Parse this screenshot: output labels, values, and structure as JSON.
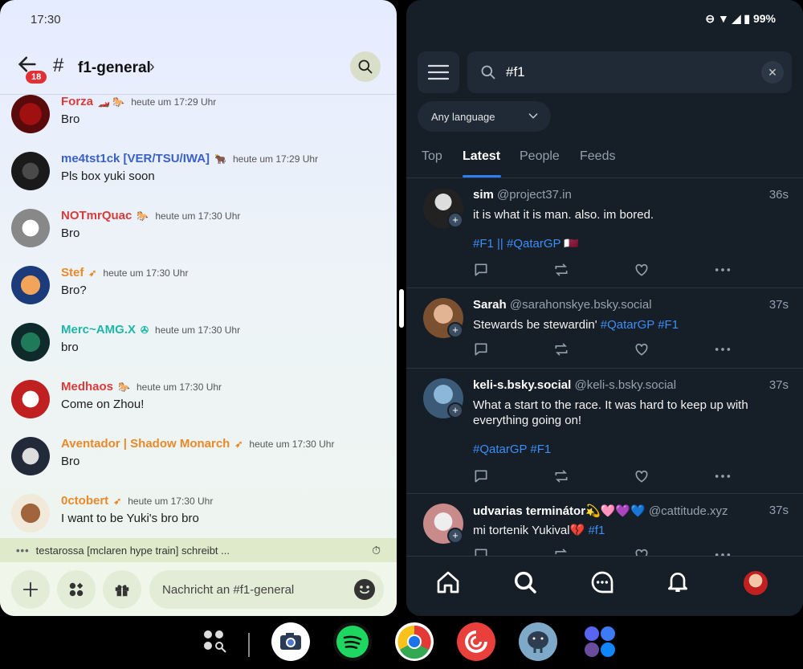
{
  "discord": {
    "status_time": "17:30",
    "badge_count": "18",
    "channel_hash": "#",
    "channel_name": "f1-general",
    "messages": [
      {
        "user": "Forza",
        "deco": "🏎️ 🐎",
        "time": "heute um 17:29 Uhr",
        "text": "Bro",
        "color": "#d93b3b"
      },
      {
        "user": "me4tst1ck [VER/TSU/IWA]",
        "deco": "🐂",
        "time": "heute um 17:29 Uhr",
        "text": "Pls box yuki soon",
        "color": "#3a5fc8"
      },
      {
        "user": "NOTmrQuac",
        "deco": "🐎",
        "time": "heute um 17:30 Uhr",
        "text": "Bro",
        "color": "#d93b3b"
      },
      {
        "user": "Stef",
        "deco": "➶",
        "time": "heute um 17:30 Uhr",
        "text": "Bro?",
        "color": "#e8892b"
      },
      {
        "user": "Merc~AMG.X",
        "deco": "✇",
        "time": "heute um 17:30 Uhr",
        "text": "bro",
        "color": "#1fb5a8"
      },
      {
        "user": "Medhaos",
        "deco": "🐎",
        "time": "heute um 17:30 Uhr",
        "text": "Come on Zhou!",
        "color": "#d93b3b"
      },
      {
        "user": "Aventador | Shadow Monarch",
        "deco": "➶",
        "time": "heute um 17:30 Uhr",
        "text": "Bro",
        "color": "#e8892b"
      },
      {
        "user": "0ctobert",
        "deco": "➶",
        "time": "heute um 17:30 Uhr",
        "text": "I want to be Yuki's bro bro",
        "color": "#e8892b"
      }
    ],
    "typing_dots": "•••",
    "typing_text": "testarossa [mclaren hype train] schreibt ...",
    "composer_placeholder": "Nachricht an #f1-general"
  },
  "bluesky": {
    "battery": "99%",
    "search_query": "#f1",
    "language": "Any language",
    "tabs": [
      "Top",
      "Latest",
      "People",
      "Feeds"
    ],
    "posts": [
      {
        "name": "sim",
        "handle": "@project37.in",
        "age": "36s",
        "text": "it is what it is man. also. im bored.",
        "tags": "#F1 || #QatarGP 🇶🇦"
      },
      {
        "name": "Sarah",
        "handle": "@sarahonskye.bsky.social",
        "age": "37s",
        "text": "Stewards be stewardin'",
        "inline_tags": "#QatarGP #F1"
      },
      {
        "name": "keli-s.bsky.social",
        "handle": "@keli-s.bsky.social",
        "age": "37s",
        "text": "What a start to the race. It was hard to keep up with everything going on!",
        "tags": "#QatarGP #F1"
      },
      {
        "name": "udvarias terminátor💫🩷💜💙",
        "handle": "@cattitude.xyz",
        "age": "37s",
        "text": "mi tortenik Yukival💔",
        "inline_tags": "#f1"
      }
    ]
  },
  "dock": {
    "apps": [
      "app-drawer",
      "camera",
      "spotify",
      "chrome",
      "pocket-casts",
      "mastodon",
      "app-folder"
    ]
  }
}
